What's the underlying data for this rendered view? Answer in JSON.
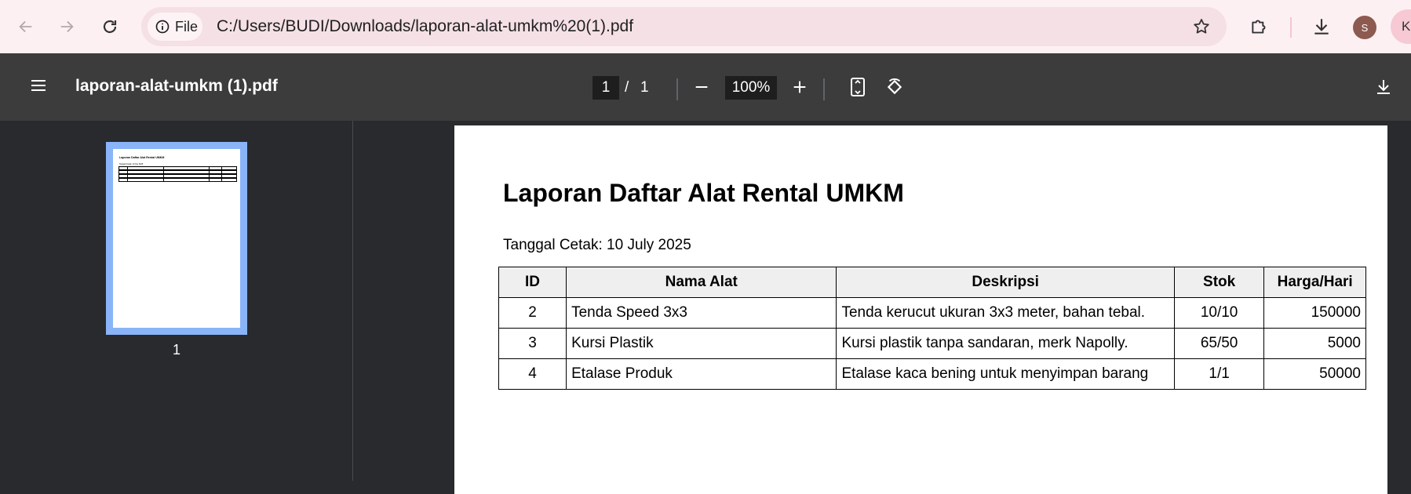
{
  "browser": {
    "file_chip_label": "File",
    "url": "C:/Users/BUDI/Downloads/laporan-alat-umkm%20(1).pdf",
    "avatar_letter": "S",
    "edge_chip_letter": "K"
  },
  "pdf_toolbar": {
    "title": "laporan-alat-umkm (1).pdf",
    "current_page": "1",
    "page_separator": "/",
    "total_pages": "1",
    "zoom": "100%"
  },
  "sidebar": {
    "thumbnail_label": "1"
  },
  "document": {
    "title": "Laporan Daftar Alat Rental UMKM",
    "print_date": "Tanggal Cetak: 10 July 2025",
    "table": {
      "headers": [
        "ID",
        "Nama Alat",
        "Deskripsi",
        "Stok",
        "Harga/Hari"
      ],
      "rows": [
        [
          "2",
          "Tenda Speed 3x3",
          "Tenda kerucut ukuran 3x3 meter, bahan tebal.",
          "10/10",
          "150000"
        ],
        [
          "3",
          "Kursi Plastik",
          "Kursi plastik tanpa sandaran, merk Napolly.",
          "65/50",
          "5000"
        ],
        [
          "4",
          "Etalase Produk",
          "Etalase kaca bening untuk menyimpan barang",
          "1/1",
          "50000"
        ]
      ]
    }
  },
  "icons": {
    "back": "arrow-left-icon",
    "forward": "arrow-right-icon",
    "reload": "reload-icon",
    "info": "info-icon",
    "bookmark": "star-icon",
    "extensions": "puzzle-icon",
    "downloads": "download-icon",
    "menu": "hamburger-icon",
    "zoom_out": "minus-icon",
    "zoom_in": "plus-icon",
    "fit": "fit-page-icon",
    "rotate": "rotate-icon",
    "pdf_download": "download-icon"
  },
  "colors": {
    "browser_bar": "#fdf0f3",
    "omnibox": "#f5e0e5",
    "pdf_toolbar": "#3c3c3c",
    "viewer_bg": "#282a2d",
    "thumb_selected": "#8ab4f8",
    "table_header_bg": "#efefef"
  }
}
